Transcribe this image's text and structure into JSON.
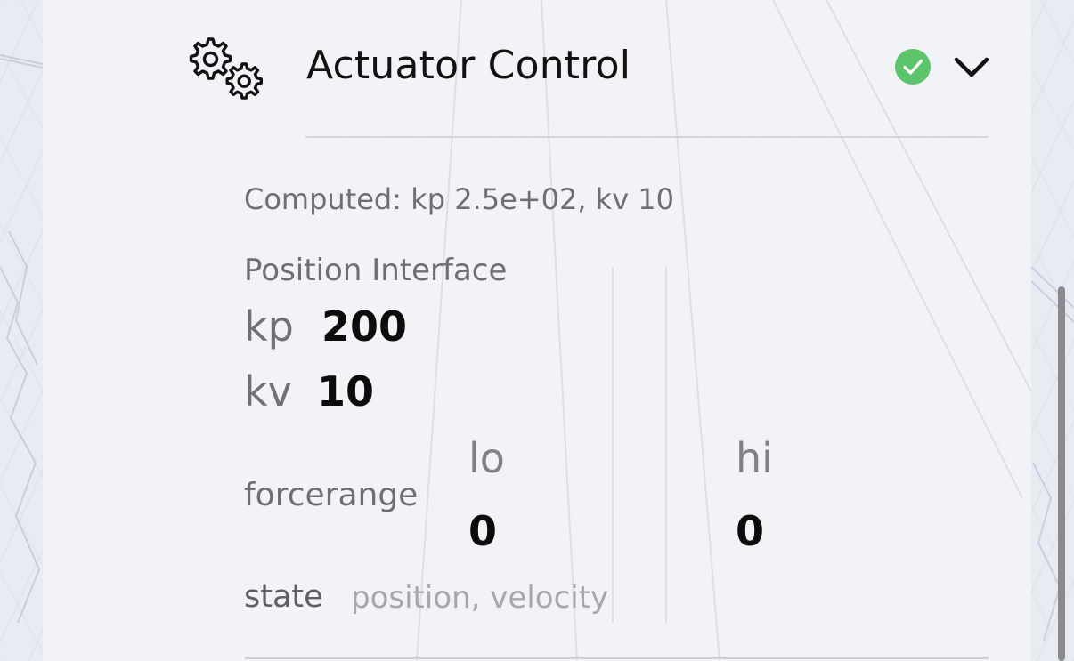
{
  "header": {
    "title": "Actuator Control",
    "icon": "gears-icon",
    "status_icon": "check-circle-icon",
    "status_color": "#5cc46a",
    "toggle_icon": "chevron-down-icon"
  },
  "computed_text": "Computed: kp 2.5e+02, kv 10",
  "position_interface": {
    "title": "Position Interface",
    "kp": {
      "label": "kp",
      "value": "200"
    },
    "kv": {
      "label": "kv",
      "value": "10"
    }
  },
  "forcerange": {
    "label": "forcerange",
    "lo": {
      "label": "lo",
      "value": "0"
    },
    "hi": {
      "label": "hi",
      "value": "0"
    }
  },
  "state": {
    "label": "state",
    "value": "position, velocity"
  },
  "colors": {
    "text_primary": "#0c0c0c",
    "text_secondary": "#6e6e74",
    "text_muted": "#a6a6ac",
    "panel_bg": "#f4f4f8"
  }
}
